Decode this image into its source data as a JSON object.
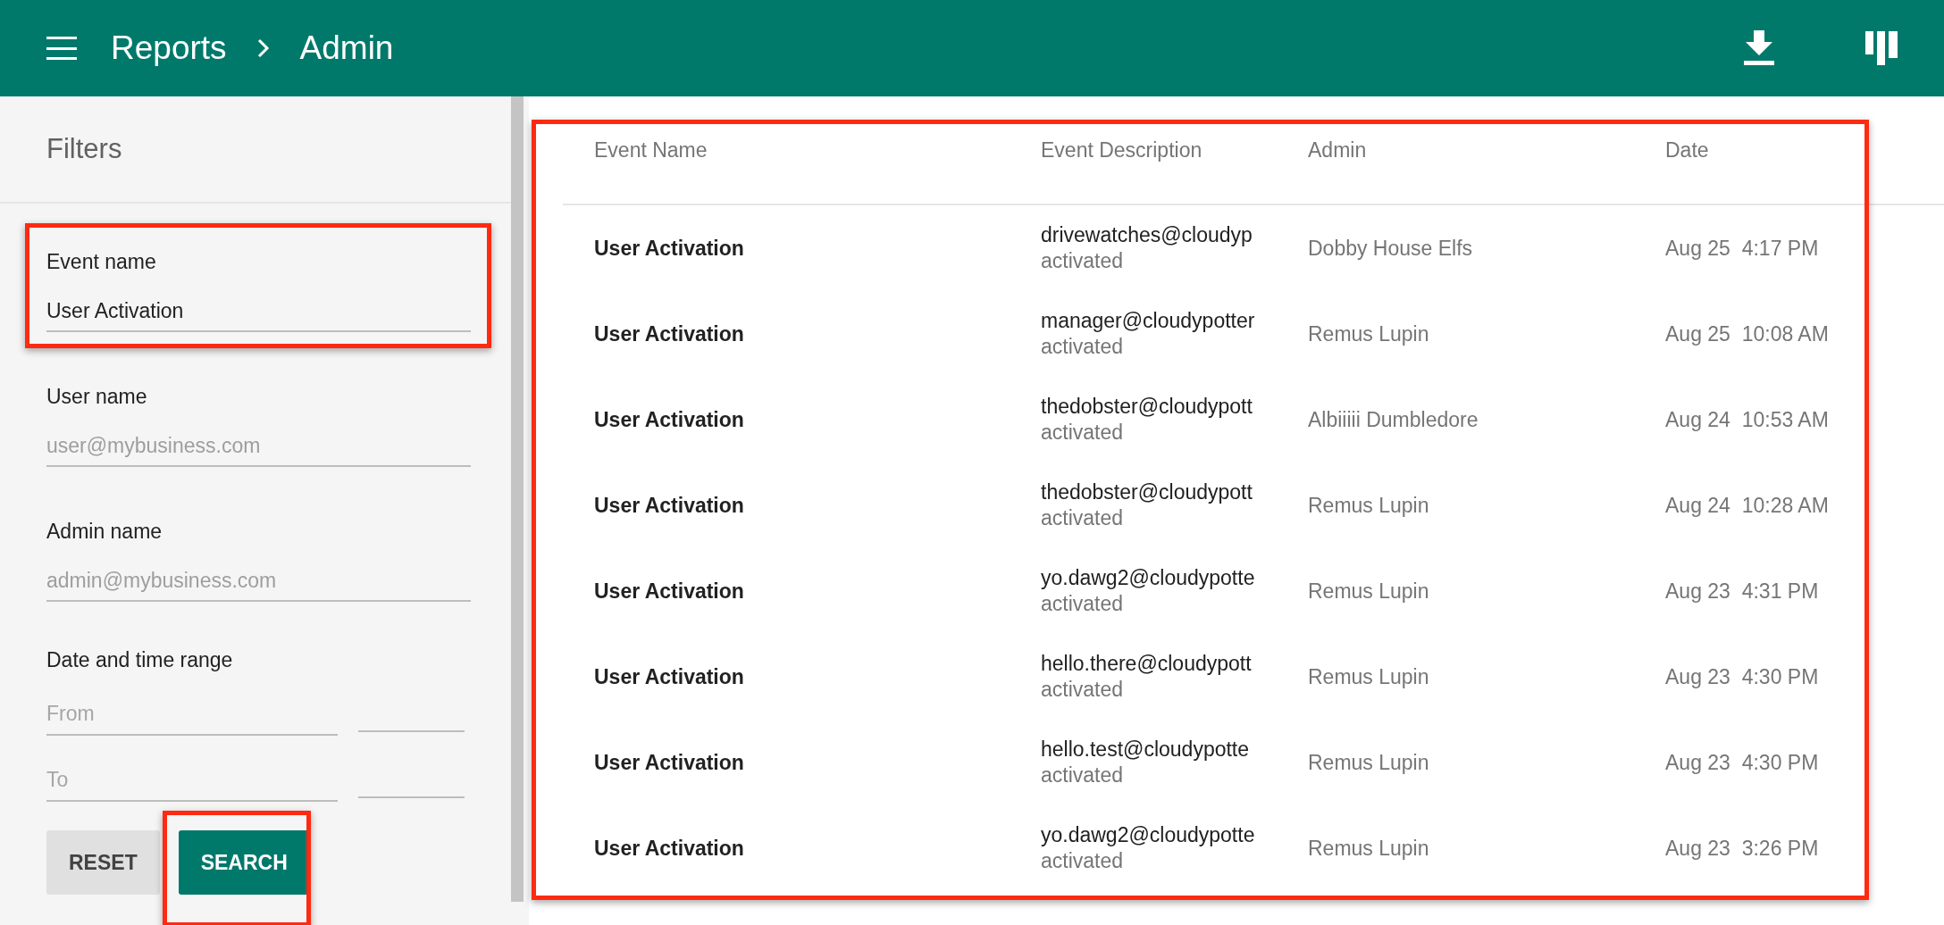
{
  "header": {
    "breadcrumb": [
      "Reports",
      "Admin"
    ]
  },
  "filters": {
    "title": "Filters",
    "fields": [
      {
        "kind": "text",
        "label": "Event name",
        "value": "User Activation",
        "highlighted": true
      },
      {
        "kind": "text",
        "label": "User name",
        "placeholder": "user@mybusiness.com",
        "highlighted": false
      },
      {
        "kind": "text",
        "label": "Admin name",
        "placeholder": "admin@mybusiness.com",
        "highlighted": false
      },
      {
        "kind": "range",
        "label": "Date and time range",
        "from_placeholder": "From",
        "to_placeholder": "To",
        "highlighted": false
      }
    ],
    "buttons": [
      {
        "kind": "flat",
        "label": "RESET",
        "highlighted": false
      },
      {
        "kind": "primary",
        "label": "SEARCH",
        "highlighted": true
      }
    ]
  },
  "table": {
    "highlighted": true,
    "columns": [
      "Event Name",
      "Event Description",
      "Admin",
      "Date"
    ],
    "rows": [
      {
        "event": "User Activation",
        "description": "drivewatches@cloudyp",
        "status": "activated",
        "admin": "Dobby House Elfs",
        "date": "Aug 25  4:17 PM"
      },
      {
        "event": "User Activation",
        "description": "manager@cloudypotter",
        "status": "activated",
        "admin": "Remus Lupin",
        "date": "Aug 25  10:08 AM"
      },
      {
        "event": "User Activation",
        "description": "thedobster@cloudypott",
        "status": "activated",
        "admin": "Albiiiii Dumbledore",
        "date": "Aug 24  10:53 AM"
      },
      {
        "event": "User Activation",
        "description": "thedobster@cloudypott",
        "status": "activated",
        "admin": "Remus Lupin",
        "date": "Aug 24  10:28 AM"
      },
      {
        "event": "User Activation",
        "description": "yo.dawg2@cloudypotte",
        "status": "activated",
        "admin": "Remus Lupin",
        "date": "Aug 23  4:31 PM"
      },
      {
        "event": "User Activation",
        "description": "hello.there@cloudypott",
        "status": "activated",
        "admin": "Remus Lupin",
        "date": "Aug 23  4:30 PM"
      },
      {
        "event": "User Activation",
        "description": "hello.test@cloudypotte",
        "status": "activated",
        "admin": "Remus Lupin",
        "date": "Aug 23  4:30 PM"
      },
      {
        "event": "User Activation",
        "description": "yo.dawg2@cloudypotte",
        "status": "activated",
        "admin": "Remus Lupin",
        "date": "Aug 23  3:26 PM"
      }
    ]
  }
}
